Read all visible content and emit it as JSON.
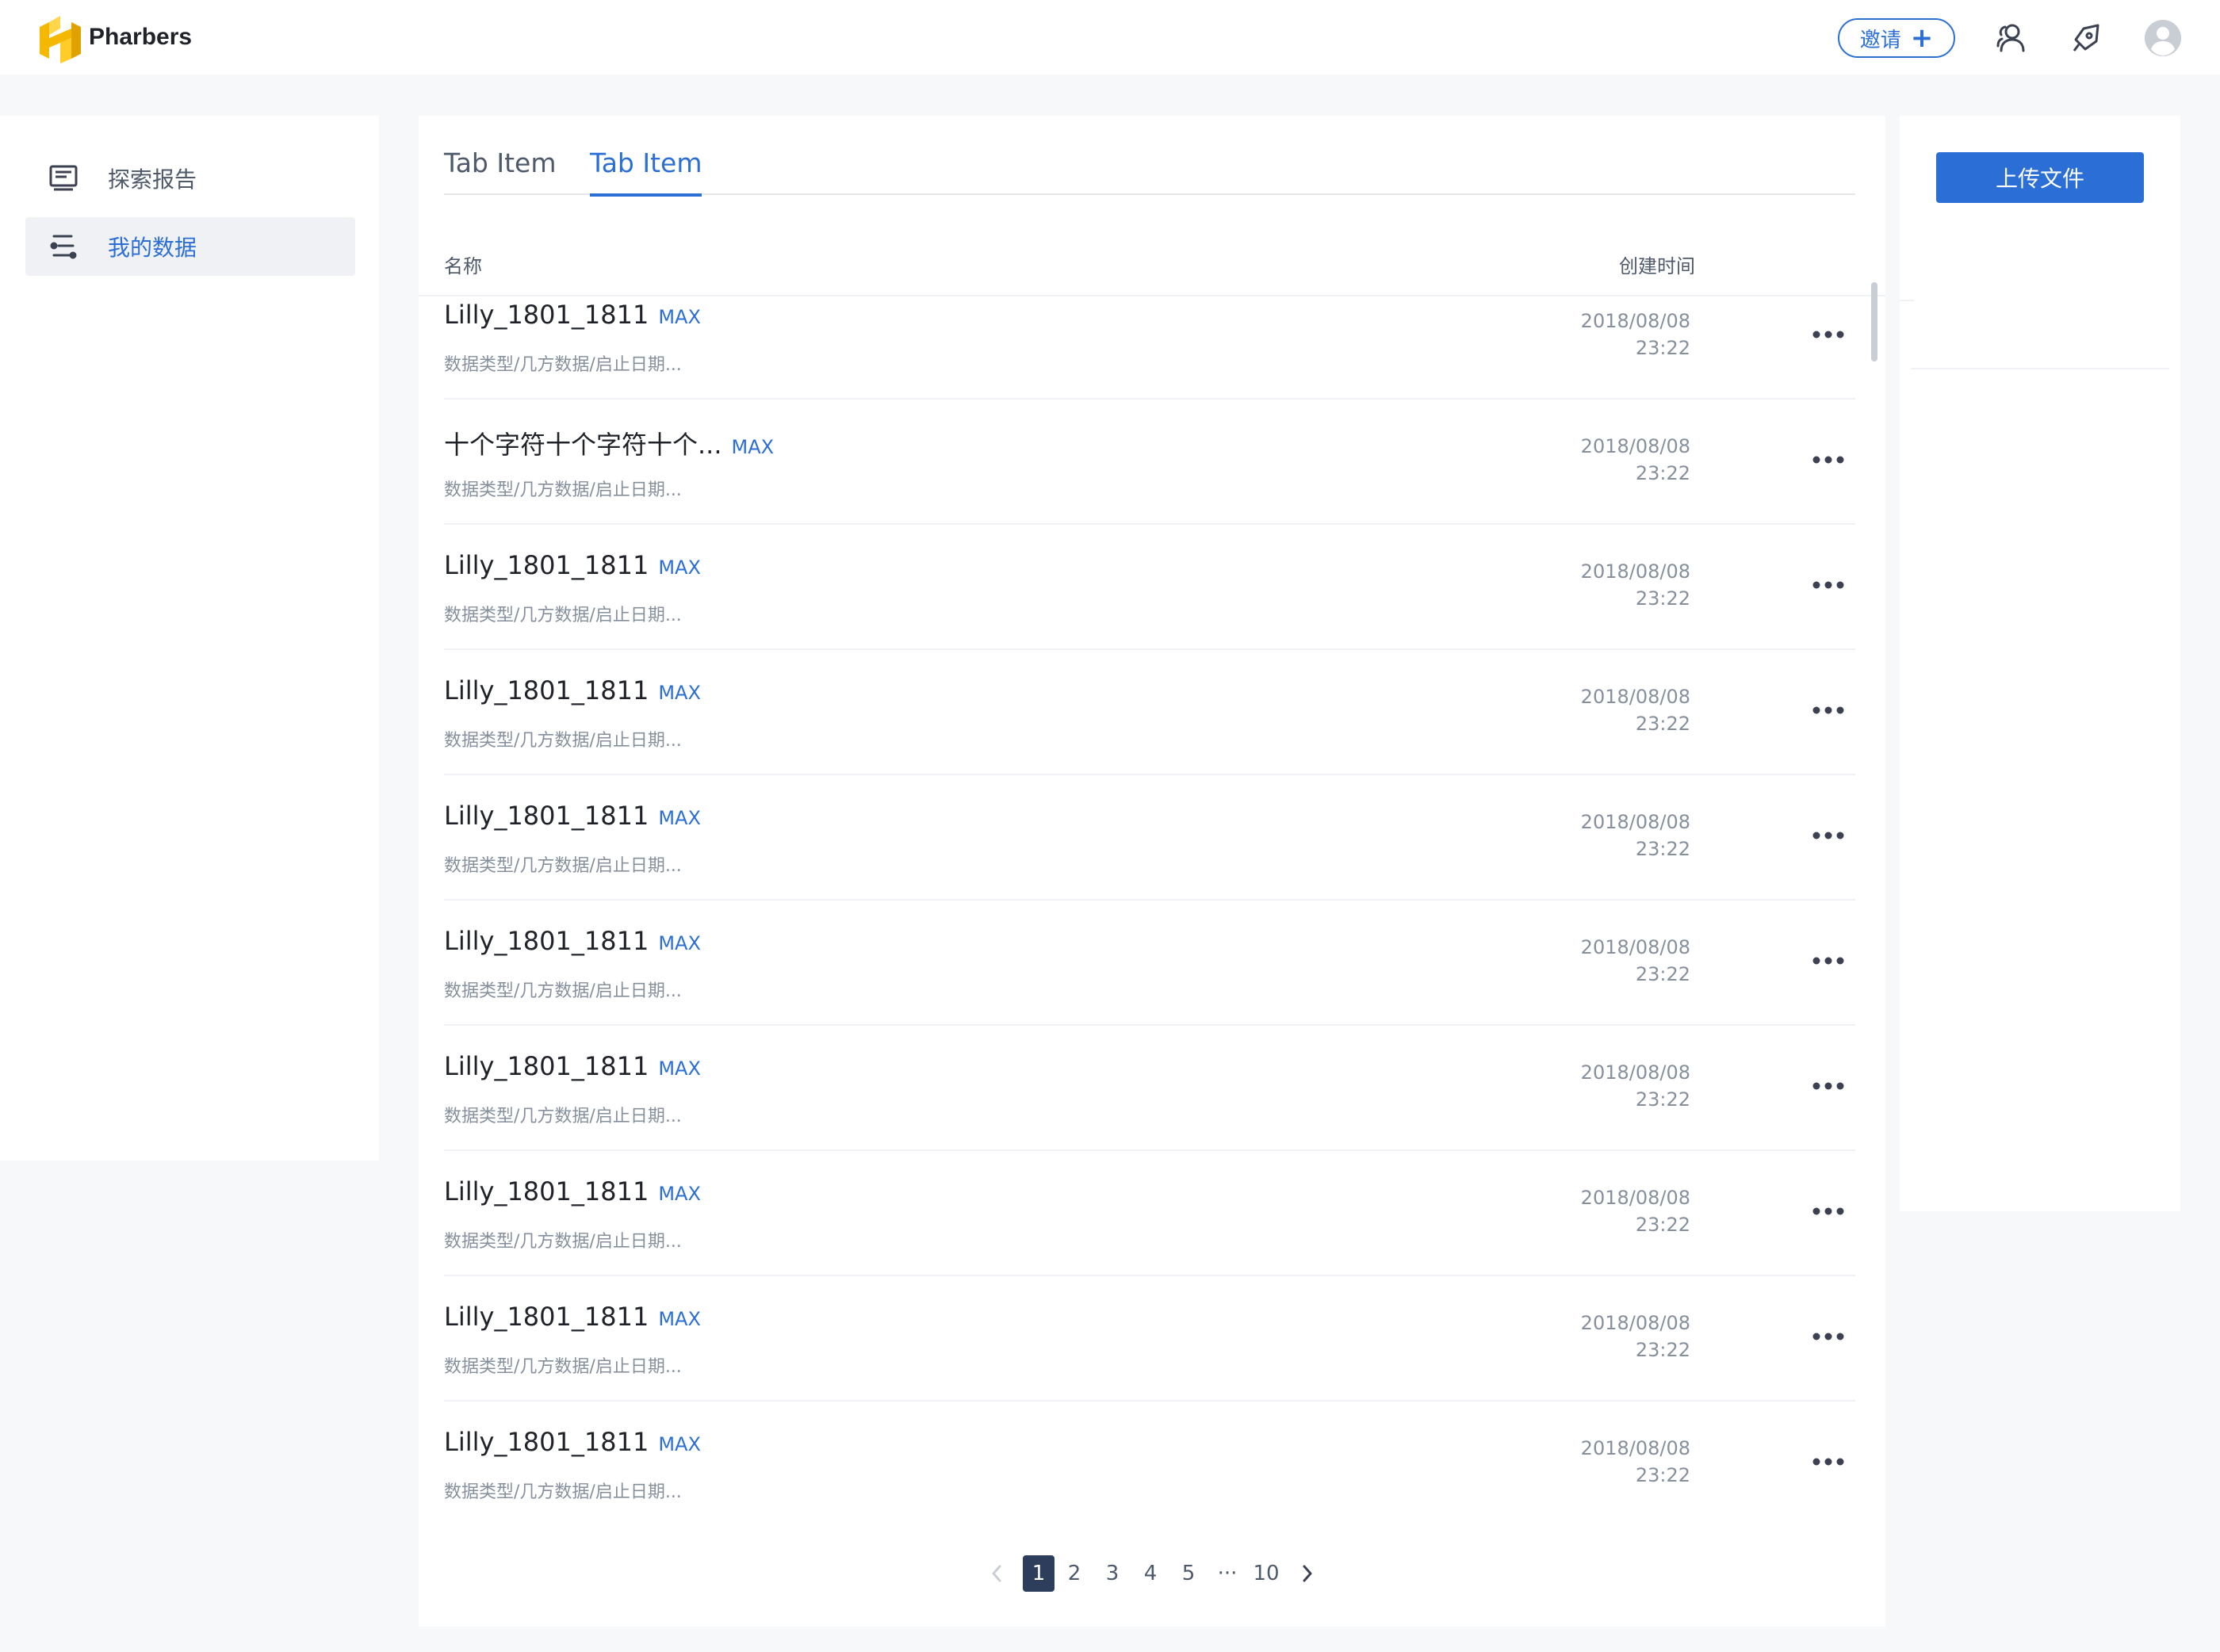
{
  "app": {
    "logo_text": "Pharbers",
    "invite_label": "邀请",
    "invite_plus": "+"
  },
  "sidebar": {
    "items": [
      {
        "label": "探索报告",
        "icon": "report-icon",
        "active": false
      },
      {
        "label": "我的数据",
        "icon": "data-icon",
        "active": true
      }
    ]
  },
  "main": {
    "tabs": [
      {
        "label": "Tab Item",
        "active": false
      },
      {
        "label": "Tab Item",
        "active": true
      }
    ],
    "columns": {
      "name": "名称",
      "created": "创建时间"
    },
    "rows": [
      {
        "name": "Lilly_1801_1811",
        "tag": "MAX",
        "desc": "数据类型/几方数据/启止日期...",
        "date": "2018/08/08",
        "time": "23:22"
      },
      {
        "name": "十个字符十个字符十个...",
        "tag": "MAX",
        "desc": "数据类型/几方数据/启止日期...",
        "date": "2018/08/08",
        "time": "23:22"
      },
      {
        "name": "Lilly_1801_1811",
        "tag": "MAX",
        "desc": "数据类型/几方数据/启止日期...",
        "date": "2018/08/08",
        "time": "23:22"
      },
      {
        "name": "Lilly_1801_1811",
        "tag": "MAX",
        "desc": "数据类型/几方数据/启止日期...",
        "date": "2018/08/08",
        "time": "23:22"
      },
      {
        "name": "Lilly_1801_1811",
        "tag": "MAX",
        "desc": "数据类型/几方数据/启止日期...",
        "date": "2018/08/08",
        "time": "23:22"
      },
      {
        "name": "Lilly_1801_1811",
        "tag": "MAX",
        "desc": "数据类型/几方数据/启止日期...",
        "date": "2018/08/08",
        "time": "23:22"
      },
      {
        "name": "Lilly_1801_1811",
        "tag": "MAX",
        "desc": "数据类型/几方数据/启止日期...",
        "date": "2018/08/08",
        "time": "23:22"
      },
      {
        "name": "Lilly_1801_1811",
        "tag": "MAX",
        "desc": "数据类型/几方数据/启止日期...",
        "date": "2018/08/08",
        "time": "23:22"
      },
      {
        "name": "Lilly_1801_1811",
        "tag": "MAX",
        "desc": "数据类型/几方数据/启止日期...",
        "date": "2018/08/08",
        "time": "23:22"
      },
      {
        "name": "Lilly_1801_1811",
        "tag": "MAX",
        "desc": "数据类型/几方数据/启止日期...",
        "date": "2018/08/08",
        "time": "23:22"
      }
    ],
    "more_icon": "ellipsis-icon",
    "pagination": {
      "pages": [
        "1",
        "2",
        "3",
        "4",
        "5"
      ],
      "ellipsis": "···",
      "last": "10",
      "current": "1"
    }
  },
  "right_panel": {
    "upload_label": "上传文件"
  },
  "colors": {
    "accent": "#2b6fd6",
    "active_page": "#2c3e5c",
    "logo_yellow": "#f5b800"
  }
}
